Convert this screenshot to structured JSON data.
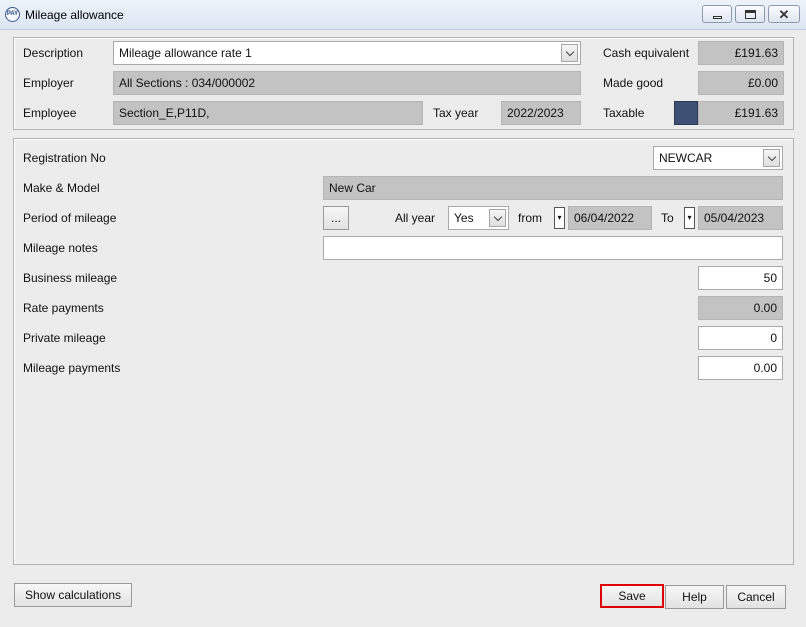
{
  "window": {
    "title": "Mileage allowance"
  },
  "header": {
    "description_label": "Description",
    "description_value": "Mileage allowance rate 1",
    "employer_label": "Employer",
    "employer_value": "All Sections : 034/000002",
    "employee_label": "Employee",
    "employee_value": "Section_E,P11D,",
    "tax_year_label": "Tax year",
    "tax_year_value": "2022/2023",
    "cash_equivalent_label": "Cash equivalent",
    "cash_equivalent_value": "£191.63",
    "made_good_label": "Made good",
    "made_good_value": "£0.00",
    "taxable_label": "Taxable",
    "taxable_value": "£191.63",
    "taxable_swatch_color": "#3e5073"
  },
  "form": {
    "registration_label": "Registration No",
    "registration_value": "NEWCAR",
    "make_model_label": "Make & Model",
    "make_model_value": "New Car",
    "period_label": "Period of mileage",
    "period_button": "...",
    "all_year_label": "All year",
    "all_year_value": "Yes",
    "from_label": "from",
    "from_date": "06/04/2022",
    "to_label": "To",
    "to_date": "05/04/2023",
    "notes_label": "Mileage notes",
    "notes_value": "",
    "business_mileage_label": "Business mileage",
    "business_mileage_value": "50",
    "rate_payments_label": "Rate payments",
    "rate_payments_value": "0.00",
    "private_mileage_label": "Private mileage",
    "private_mileage_value": "0",
    "mileage_payments_label": "Mileage payments",
    "mileage_payments_value": "0.00"
  },
  "footer": {
    "show_calculations": "Show calculations",
    "save": "Save",
    "help": "Help",
    "cancel": "Cancel"
  }
}
